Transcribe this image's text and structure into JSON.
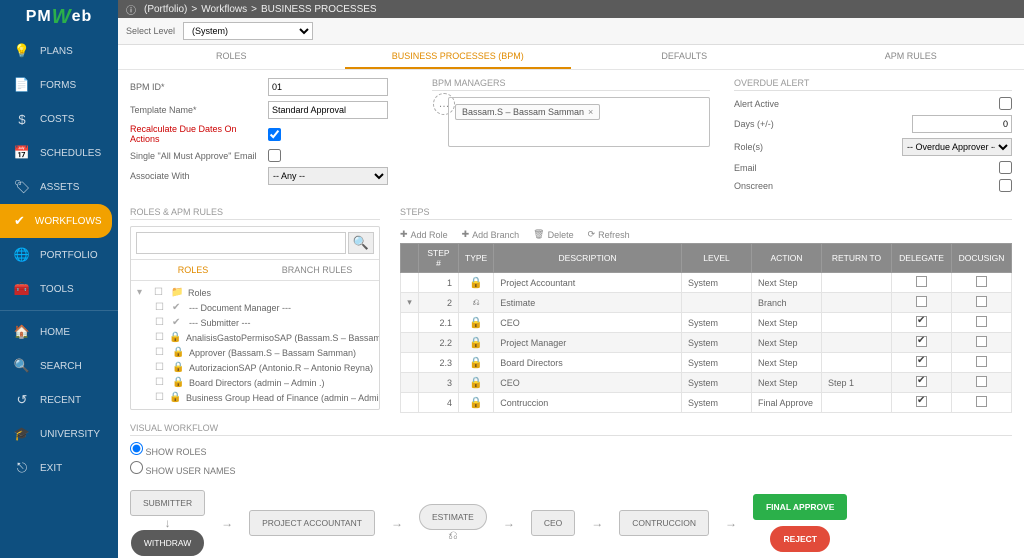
{
  "logo": {
    "pre": "PM",
    "mid": "W",
    "suf": "eb"
  },
  "breadcrumb": {
    "info_icon": "ⓘ",
    "portfolio": "(Portfolio)",
    "sep": ">",
    "workflows": "Workflows",
    "page": "BUSINESS PROCESSES"
  },
  "subbar": {
    "select_level_label": "Select Level",
    "select_level_value": "(System)"
  },
  "nav": [
    {
      "icon": "💡",
      "label": "PLANS"
    },
    {
      "icon": "📄",
      "label": "FORMS"
    },
    {
      "icon": "$",
      "label": "COSTS"
    },
    {
      "icon": "📅",
      "label": "SCHEDULES"
    },
    {
      "icon": "🏷",
      "label": "ASSETS"
    },
    {
      "icon": "✔",
      "label": "WORKFLOWS",
      "active": true
    },
    {
      "icon": "🌐",
      "label": "PORTFOLIO"
    },
    {
      "icon": "🧰",
      "label": "TOOLS"
    }
  ],
  "nav2": [
    {
      "icon": "🏠",
      "label": "HOME"
    },
    {
      "icon": "🔍",
      "label": "SEARCH"
    },
    {
      "icon": "↺",
      "label": "RECENT"
    },
    {
      "icon": "🎓",
      "label": "UNIVERSITY"
    },
    {
      "icon": "⎋",
      "label": "EXIT"
    }
  ],
  "tabs": {
    "roles": "ROLES",
    "bpm": "BUSINESS PROCESSES (BPM)",
    "defaults": "DEFAULTS",
    "apm": "APM RULES"
  },
  "form": {
    "bpm_id_label": "BPM ID*",
    "bpm_id_value": "01",
    "template_label": "Template Name*",
    "template_value": "Standard Approval",
    "recalc_label": "Recalculate Due Dates On Actions",
    "single_label": "Single \"All Must Approve\" Email",
    "assoc_label": "Associate With",
    "assoc_value": "-- Any --"
  },
  "managers": {
    "title": "BPM MANAGERS",
    "tag": "Bassam.S – Bassam Samman"
  },
  "overdue": {
    "title": "OVERDUE ALERT",
    "alert_active": "Alert Active",
    "days_label": "Days (+/-)",
    "days_value": "0",
    "roles_label": "Role(s)",
    "roles_value": "-- Overdue Approver --",
    "email": "Email",
    "onscreen": "Onscreen"
  },
  "roles_rules": {
    "title": "ROLES & APM RULES",
    "tab_roles": "ROLES",
    "tab_branch": "BRANCH RULES",
    "root": "Roles",
    "items": [
      {
        "ic": "✔",
        "label": "--- Document Manager ---"
      },
      {
        "ic": "✔",
        "label": "--- Submitter ---"
      },
      {
        "ic": "🔒",
        "label": "AnalisisGastoPermisoSAP (Bassam.S – Bassam Sam"
      },
      {
        "ic": "🔒",
        "label": "Approver (Bassam.S – Bassam Samman)"
      },
      {
        "ic": "🔒",
        "label": "AutorizacionSAP (Antonio.R – Antonio Reyna)"
      },
      {
        "ic": "🔒",
        "label": "Board Directors (admin – Admin .)"
      },
      {
        "ic": "🔒",
        "label": "Business Group Head of Finance (admin – Admin .)"
      }
    ]
  },
  "steps": {
    "title": "STEPS",
    "toolbar": {
      "add_role": "Add Role",
      "add_branch": "Add Branch",
      "delete": "Delete",
      "refresh": "Refresh"
    },
    "cols": {
      "step": "STEP #",
      "type": "TYPE",
      "desc": "DESCRIPTION",
      "level": "LEVEL",
      "action": "ACTION",
      "return_to": "RETURN TO",
      "delegate": "DELEGATE",
      "docusign": "DOCUSIGN"
    },
    "rows": [
      {
        "step": "1",
        "type": "🔒",
        "desc": "Project Accountant",
        "level": "System",
        "action": "Next Step",
        "return": "",
        "delegate": false,
        "docusign": false
      },
      {
        "step": "2",
        "type": "branch",
        "desc": "Estimate",
        "level": "",
        "action": "Branch",
        "return": "",
        "delegate": false,
        "docusign": false
      },
      {
        "step": "2.1",
        "type": "🔒",
        "desc": "CEO",
        "level": "System",
        "action": "Next Step",
        "return": "",
        "delegate": true,
        "docusign": false
      },
      {
        "step": "2.2",
        "type": "🔒",
        "desc": "Project Manager",
        "level": "System",
        "action": "Next Step",
        "return": "",
        "delegate": true,
        "docusign": false
      },
      {
        "step": "2.3",
        "type": "🔒",
        "desc": "Board Directors",
        "level": "System",
        "action": "Next Step",
        "return": "",
        "delegate": true,
        "docusign": false
      },
      {
        "step": "3",
        "type": "🔒",
        "desc": "CEO",
        "level": "System",
        "action": "Next Step",
        "return": "Step 1",
        "delegate": true,
        "docusign": false
      },
      {
        "step": "4",
        "type": "🔒",
        "desc": "Contruccion",
        "level": "System",
        "action": "Final Approve",
        "return": "",
        "delegate": true,
        "docusign": false
      }
    ]
  },
  "visual": {
    "title": "VISUAL WORKFLOW",
    "opt_roles": "SHOW ROLES",
    "opt_users": "SHOW USER NAMES",
    "nodes": {
      "submitter": "SUBMITTER",
      "pa": "PROJECT ACCOUNTANT",
      "estimate": "ESTIMATE",
      "ceo": "CEO",
      "contruccion": "CONTRUCCION",
      "final": "FINAL APPROVE",
      "withdraw": "WITHDRAW",
      "reject": "REJECT"
    }
  }
}
